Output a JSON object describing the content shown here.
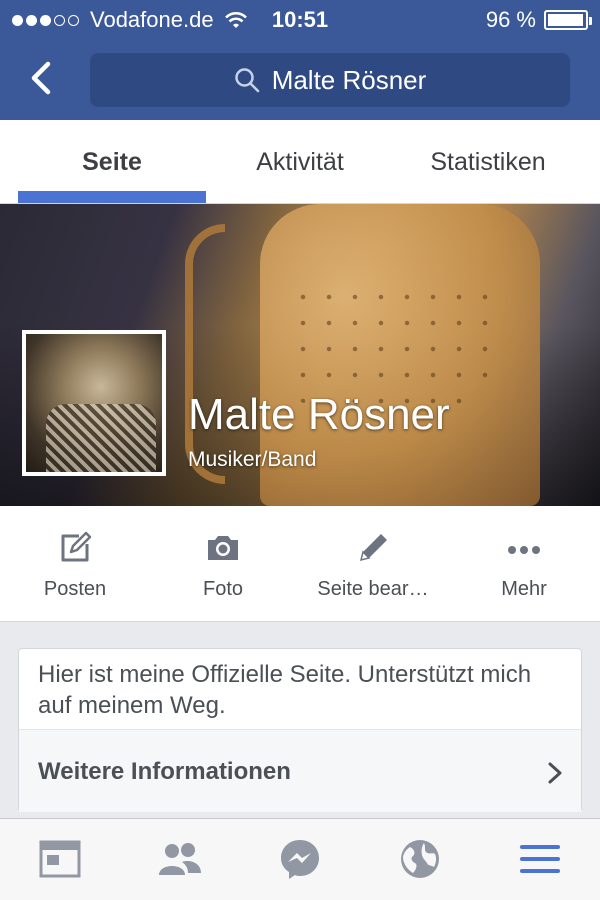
{
  "status_bar": {
    "carrier": "Vodafone.de",
    "time": "10:51",
    "battery": "96 %",
    "battery_level": 0.96,
    "signal_bars": 3
  },
  "nav": {
    "search_text": "Malte Rösner"
  },
  "tabs": [
    {
      "label": "Seite",
      "active": true
    },
    {
      "label": "Aktivität",
      "active": false
    },
    {
      "label": "Statistiken",
      "active": false
    }
  ],
  "profile": {
    "name": "Malte Rösner",
    "category": "Musiker/Band"
  },
  "actions": [
    {
      "label": "Posten",
      "icon": "compose-icon"
    },
    {
      "label": "Foto",
      "icon": "camera-icon"
    },
    {
      "label": "Seite bear…",
      "icon": "pencil-icon"
    },
    {
      "label": "Mehr",
      "icon": "more-icon"
    }
  ],
  "about": {
    "text": "Hier ist meine Offizielle Seite. Unterstützt mich auf meinem Weg.",
    "more_label": "Weitere Informationen"
  },
  "colors": {
    "header": "#3b5998",
    "accent": "#4a73d4",
    "icon_gray": "#9197a3"
  }
}
